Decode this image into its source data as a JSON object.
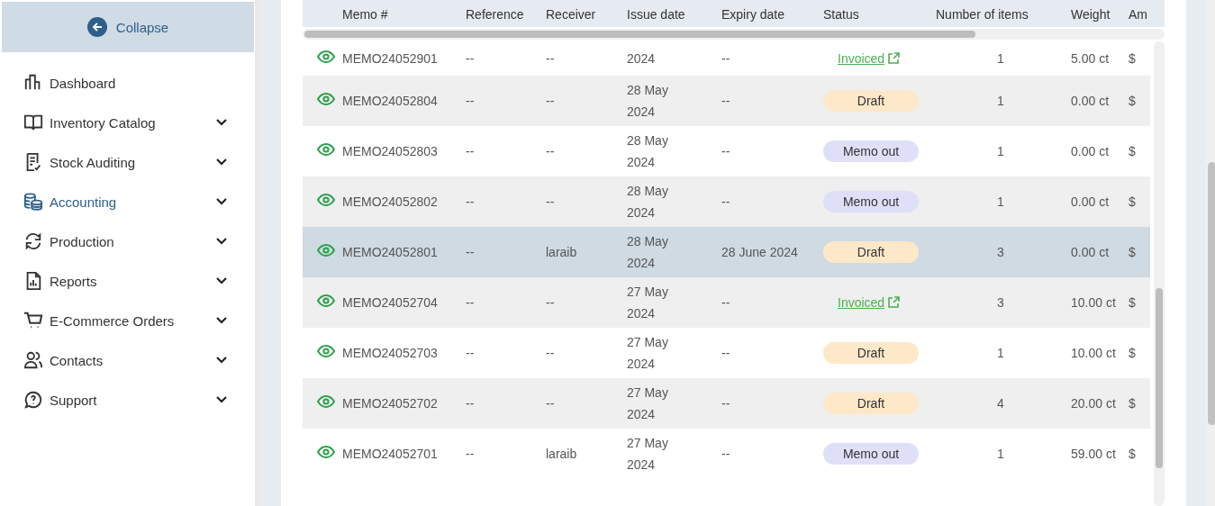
{
  "sidebar": {
    "collapse_label": "Collapse",
    "items": [
      {
        "label": "Dashboard",
        "selected": false,
        "has_submenu": false
      },
      {
        "label": "Inventory Catalog",
        "selected": false,
        "has_submenu": true
      },
      {
        "label": "Stock Auditing",
        "selected": false,
        "has_submenu": true
      },
      {
        "label": "Accounting",
        "selected": true,
        "has_submenu": true
      },
      {
        "label": "Production",
        "selected": false,
        "has_submenu": true
      },
      {
        "label": "Reports",
        "selected": false,
        "has_submenu": true
      },
      {
        "label": "E-Commerce Orders",
        "selected": false,
        "has_submenu": true
      },
      {
        "label": "Contacts",
        "selected": false,
        "has_submenu": true
      },
      {
        "label": "Support",
        "selected": false,
        "has_submenu": true
      }
    ]
  },
  "table": {
    "columns": [
      "Memo #",
      "Reference",
      "Receiver",
      "Issue date",
      "Expiry date",
      "Status",
      "Number of items",
      "Weight",
      "Am"
    ],
    "rows": [
      {
        "memo": "MEMO24052901",
        "reference": "--",
        "receiver": "--",
        "issue_date": "2024",
        "expiry_date": "--",
        "status": {
          "kind": "invoiced",
          "label": "Invoiced"
        },
        "items": "1",
        "weight": "5.00 ct",
        "amount": "$",
        "selected": false
      },
      {
        "memo": "MEMO24052804",
        "reference": "--",
        "receiver": "--",
        "issue_date": "28 May 2024",
        "expiry_date": "--",
        "status": {
          "kind": "draft",
          "label": "Draft"
        },
        "items": "1",
        "weight": "0.00 ct",
        "amount": "$",
        "selected": false
      },
      {
        "memo": "MEMO24052803",
        "reference": "--",
        "receiver": "--",
        "issue_date": "28 May 2024",
        "expiry_date": "--",
        "status": {
          "kind": "memo_out",
          "label": "Memo out"
        },
        "items": "1",
        "weight": "0.00 ct",
        "amount": "$",
        "selected": false
      },
      {
        "memo": "MEMO24052802",
        "reference": "--",
        "receiver": "--",
        "issue_date": "28 May 2024",
        "expiry_date": "--",
        "status": {
          "kind": "memo_out",
          "label": "Memo out"
        },
        "items": "1",
        "weight": "0.00 ct",
        "amount": "$",
        "selected": false
      },
      {
        "memo": "MEMO24052801",
        "reference": "--",
        "receiver": "laraib",
        "issue_date": "28 May 2024",
        "expiry_date": "28 June 2024",
        "status": {
          "kind": "draft",
          "label": "Draft"
        },
        "items": "3",
        "weight": "0.00 ct",
        "amount": "$",
        "selected": true
      },
      {
        "memo": "MEMO24052704",
        "reference": "--",
        "receiver": "--",
        "issue_date": "27 May 2024",
        "expiry_date": "--",
        "status": {
          "kind": "invoiced",
          "label": "Invoiced"
        },
        "items": "3",
        "weight": "10.00 ct",
        "amount": "$",
        "selected": false
      },
      {
        "memo": "MEMO24052703",
        "reference": "--",
        "receiver": "--",
        "issue_date": "27 May 2024",
        "expiry_date": "--",
        "status": {
          "kind": "draft",
          "label": "Draft"
        },
        "items": "1",
        "weight": "10.00 ct",
        "amount": "$",
        "selected": false
      },
      {
        "memo": "MEMO24052702",
        "reference": "--",
        "receiver": "--",
        "issue_date": "27 May 2024",
        "expiry_date": "--",
        "status": {
          "kind": "draft",
          "label": "Draft"
        },
        "items": "4",
        "weight": "20.00 ct",
        "amount": "$",
        "selected": false
      },
      {
        "memo": "MEMO24052701",
        "reference": "--",
        "receiver": "laraib",
        "issue_date": "27 May 2024",
        "expiry_date": "--",
        "status": {
          "kind": "memo_out",
          "label": "Memo out"
        },
        "items": "1",
        "weight": "59.00 ct",
        "amount": "$",
        "selected": false
      }
    ]
  }
}
